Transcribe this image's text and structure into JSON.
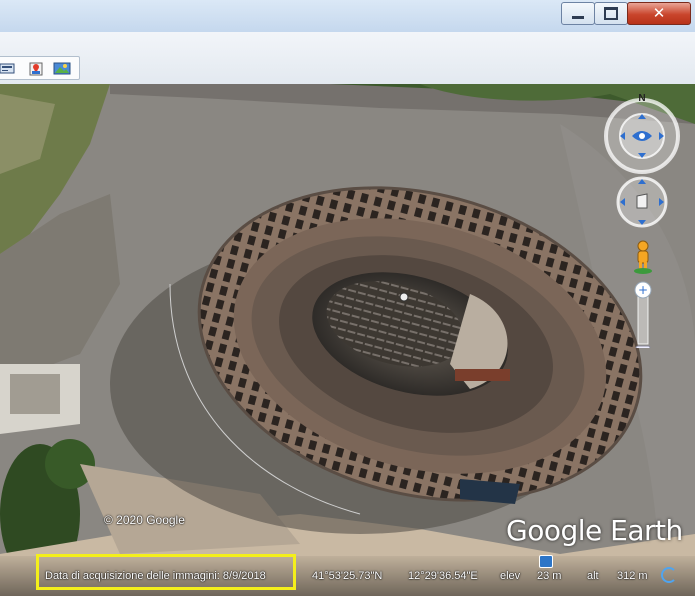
{
  "window": {
    "minimize_label": "minimize",
    "maximize_label": "maximize",
    "close_label": "close"
  },
  "toolbar": {
    "buttons": [
      "ruler-icon",
      "placemark-photo-icon",
      "image-overlay-icon"
    ]
  },
  "map": {
    "copyright": "© 2020 Google",
    "logo": "Google Earth",
    "compass_north": "N"
  },
  "status": {
    "imagery_date": "Data di acquisizione delle immagini: 8/9/2018",
    "latitude": "41°53'25.73\"N",
    "longitude": "12°29'36.54\"E",
    "elev_label": "elev",
    "elev_value": "23 m",
    "alt_label": "alt",
    "alt_value": "312 m"
  },
  "colors": {
    "highlight": "#f4ef1b",
    "titlebar": "#c5d8ee"
  }
}
